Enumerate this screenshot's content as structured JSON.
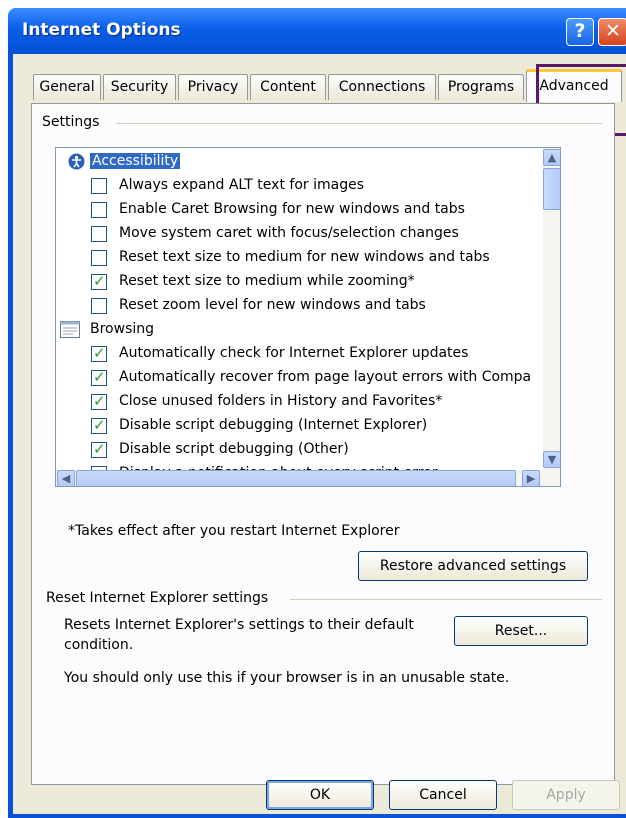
{
  "window": {
    "title": "Internet Options",
    "help_label": "?",
    "close_label": "✕"
  },
  "tabs": [
    {
      "label": "General"
    },
    {
      "label": "Security"
    },
    {
      "label": "Privacy"
    },
    {
      "label": "Content"
    },
    {
      "label": "Connections"
    },
    {
      "label": "Programs"
    },
    {
      "label": "Advanced",
      "active": true
    }
  ],
  "settings": {
    "group_label": "Settings",
    "categories": [
      {
        "label": "Accessibility",
        "selected": true,
        "icon": "accessibility-icon"
      },
      {
        "label": "Browsing",
        "selected": false,
        "icon": "browsing-icon"
      }
    ],
    "items": [
      {
        "label": "Always expand ALT text for images",
        "checked": false
      },
      {
        "label": "Enable Caret Browsing for new windows and tabs",
        "checked": false
      },
      {
        "label": "Move system caret with focus/selection changes",
        "checked": false
      },
      {
        "label": "Reset text size to medium for new windows and tabs",
        "checked": false
      },
      {
        "label": "Reset text size to medium while zooming*",
        "checked": true
      },
      {
        "label": "Reset zoom level for new windows and tabs",
        "checked": false
      },
      {
        "label": "Automatically check for Internet Explorer updates",
        "checked": true
      },
      {
        "label": "Automatically recover from page layout errors with Compa",
        "checked": true
      },
      {
        "label": "Close unused folders in History and Favorites*",
        "checked": true
      },
      {
        "label": "Disable script debugging (Internet Explorer)",
        "checked": true
      },
      {
        "label": "Disable script debugging (Other)",
        "checked": true
      },
      {
        "label": "Display a notification about every script error",
        "checked": false
      }
    ],
    "note": "*Takes effect after you restart Internet Explorer",
    "restore_label": "Restore advanced settings"
  },
  "reset": {
    "group_label": "Reset Internet Explorer settings",
    "desc_line1": "Resets Internet Explorer's settings to their default",
    "desc_line2": "condition.",
    "button_label": "Reset...",
    "warning": "You should only use this if your browser is in an unusable state."
  },
  "footer": {
    "ok": "OK",
    "cancel": "Cancel",
    "apply": "Apply"
  },
  "colors": {
    "titlebar": "#0a5fe8",
    "selection": "#316ac5",
    "tab_accent": "#ffc83c",
    "highlight_box": "#5a1a6a"
  }
}
